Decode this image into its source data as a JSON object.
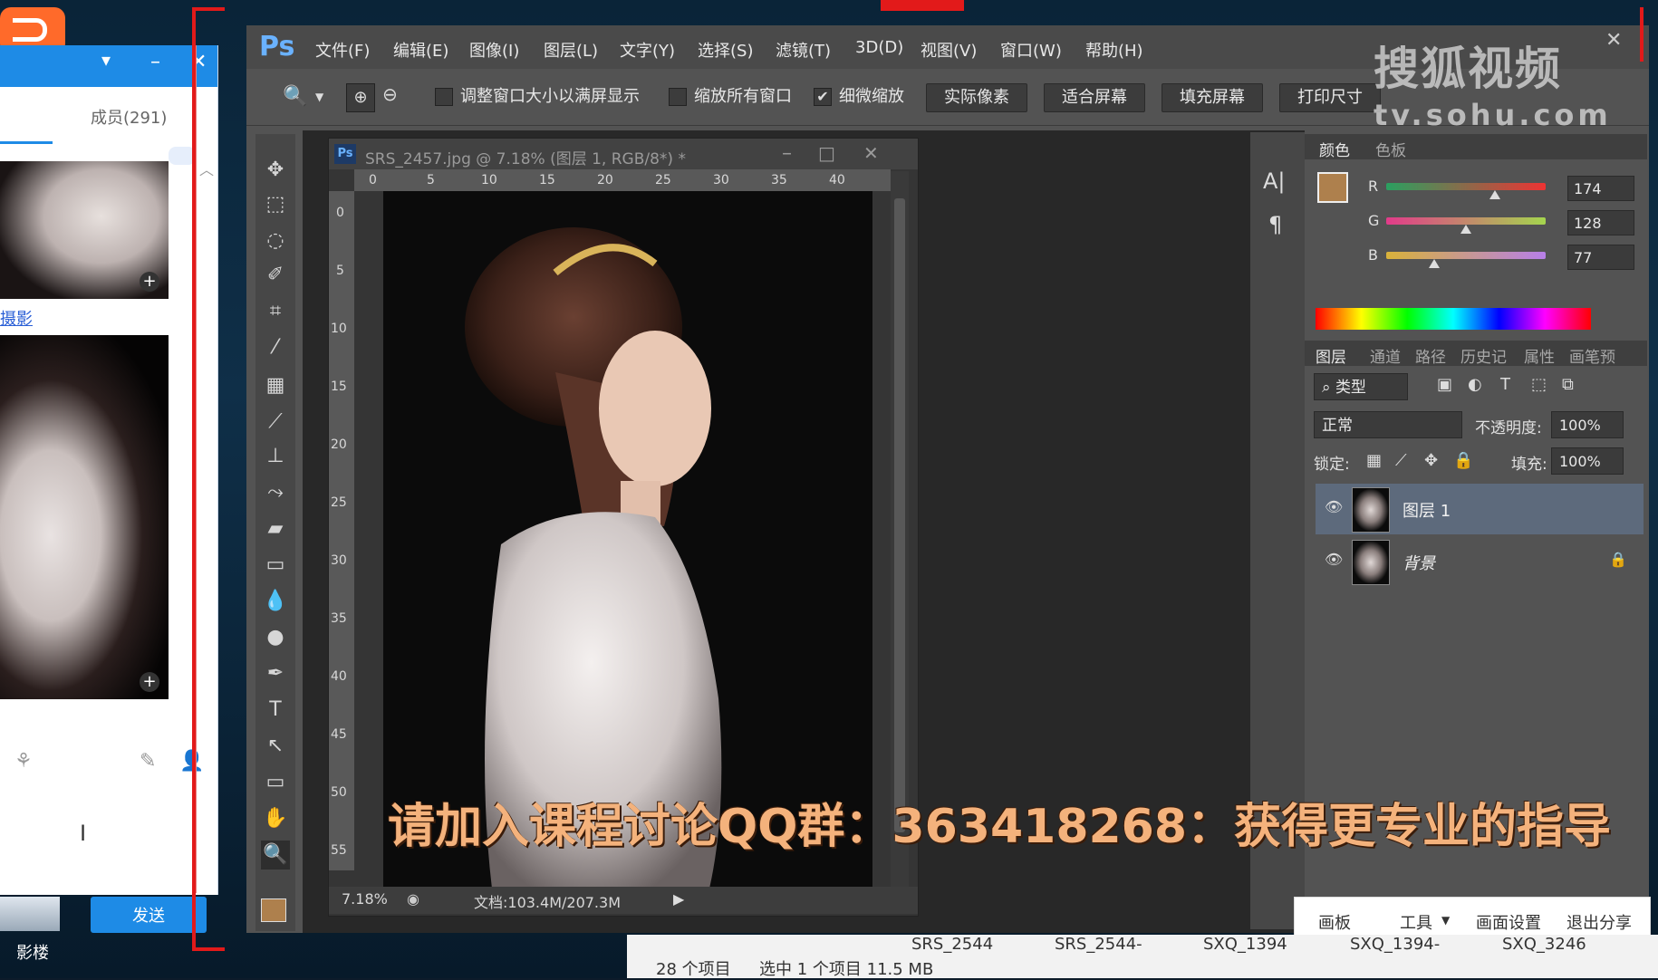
{
  "qq": {
    "members_tab": "成员(291)",
    "link_text": "摄影",
    "send_label": "发送",
    "desktop_label": "影楼"
  },
  "ps": {
    "logo": "Ps",
    "menu": [
      "文件(F)",
      "编辑(E)",
      "图像(I)",
      "图层(L)",
      "文字(Y)",
      "选择(S)",
      "滤镜(T)",
      "3D(D)",
      "视图(V)",
      "窗口(W)",
      "帮助(H)"
    ],
    "options": {
      "resize_windows": "调整窗口大小以满屏显示",
      "zoom_all": "缩放所有窗口",
      "scrubby_zoom": "细微缩放",
      "scrubby_checked": true,
      "btn_actual": "实际像素",
      "btn_fit": "适合屏幕",
      "btn_fill": "填充屏幕",
      "btn_print": "打印尺寸"
    },
    "document": {
      "title": "SRS_2457.jpg @ 7.18% (图层 1, RGB/8*) *",
      "zoom": "7.18%",
      "doc_size": "文档:103.4M/207.3M",
      "ruler_top": [
        "0",
        "5",
        "10",
        "15",
        "20",
        "25",
        "30",
        "35",
        "40"
      ],
      "ruler_left": [
        "0",
        "5",
        "10",
        "15",
        "20",
        "25",
        "30",
        "35",
        "40",
        "45",
        "50",
        "55"
      ]
    },
    "color_panel": {
      "tabs": [
        "颜色",
        "色板"
      ],
      "r_label": "R",
      "g_label": "G",
      "b_label": "B",
      "r": "174",
      "g": "128",
      "b": "77",
      "foreground": "#ae804d",
      "r_level": 0.68,
      "g_level": 0.5,
      "b_level": 0.3
    },
    "layers_panel": {
      "tabs": [
        "图层",
        "通道",
        "路径",
        "历史记",
        "属性",
        "画笔预"
      ],
      "filter": "类型",
      "blend_mode": "正常",
      "opacity_label": "不透明度:",
      "opacity": "100%",
      "lock_label": "锁定:",
      "fill_label": "填充:",
      "fill": "100%",
      "layers": [
        {
          "name": "图层 1",
          "selected": true
        },
        {
          "name": "背景",
          "selected": false,
          "locked": true
        }
      ]
    }
  },
  "watermark": {
    "text": "搜狐视频",
    "url": "tv.sohu.com"
  },
  "overlay": "请加入课程讨论QQ群：363418268：获得更专业的指导",
  "sharebar": [
    "画板",
    "工具",
    "画面设置",
    "退出分享"
  ],
  "explorer": {
    "files": [
      "SRS_2544",
      "SRS_2544-",
      "SXQ_1394",
      "SXQ_1394-",
      "SXQ_3246"
    ],
    "count": "28 个项目",
    "selected": "选中 1 个项目  11.5 MB"
  },
  "colors": {
    "accent_blue": "#1e8be6",
    "ps_bg": "#535353",
    "overlay_orange": "#f4b27c",
    "frame_red": "#e21a1a"
  }
}
